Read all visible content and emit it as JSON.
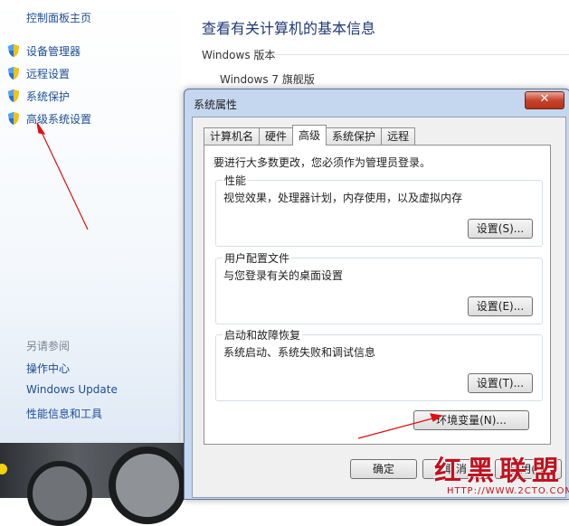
{
  "left_nav": {
    "home": "控制面板主页",
    "items": [
      {
        "label": "设备管理器",
        "icon": "shield-icon"
      },
      {
        "label": "远程设置",
        "icon": "shield-icon"
      },
      {
        "label": "系统保护",
        "icon": "shield-icon"
      },
      {
        "label": "高级系统设置",
        "icon": "shield-icon"
      }
    ],
    "see_also": {
      "title": "另请参阅",
      "items": [
        "操作中心",
        "Windows Update",
        "性能信息和工具"
      ]
    }
  },
  "main": {
    "title": "查看有关计算机的基本信息",
    "section": "Windows 版本",
    "edition": "Windows 7 旗舰版"
  },
  "dialog": {
    "title": "系统属性",
    "close_label": "✕",
    "tabs": [
      {
        "label": "计算机名",
        "active": false
      },
      {
        "label": "硬件",
        "active": false
      },
      {
        "label": "高级",
        "active": true
      },
      {
        "label": "系统保护",
        "active": false
      },
      {
        "label": "远程",
        "active": false
      }
    ],
    "notice": "要进行大多数更改，您必须作为管理员登录。",
    "groups": [
      {
        "title": "性能",
        "desc": "视觉效果，处理器计划，内存使用，以及虚拟内存",
        "button": "设置(S)..."
      },
      {
        "title": "用户配置文件",
        "desc": "与您登录有关的桌面设置",
        "button": "设置(E)..."
      },
      {
        "title": "启动和故障恢复",
        "desc": "系统启动、系统失败和调试信息",
        "button": "设置(T)..."
      }
    ],
    "env_button": "环境变量(N)...",
    "ok": "确定",
    "cancel": "取消",
    "apply": "应用(A)"
  },
  "watermark": {
    "text": "红黑联盟",
    "url": "HTTP://WWW.2CTO.COM"
  },
  "colors": {
    "link": "#1d4e96",
    "arrow": "#e01010",
    "dialog_frame": "#c5d7ee"
  }
}
